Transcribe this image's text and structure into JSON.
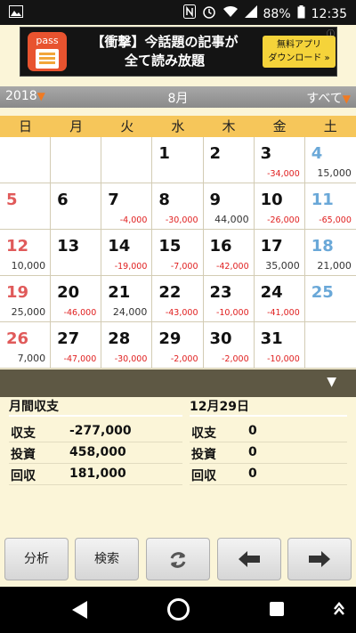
{
  "status": {
    "battery": "88%",
    "time": "12:35"
  },
  "ad": {
    "text_line1": "【衝撃】今話題の記事が",
    "text_line2": "全て読み放題",
    "logo_text": "pass",
    "cta_line1": "無料アプリ",
    "cta_line2": "ダウンロード »",
    "info": "ⓘ"
  },
  "header": {
    "year": "2018",
    "month": "8月",
    "filter": "すべて"
  },
  "weekdays": [
    "日",
    "月",
    "火",
    "水",
    "木",
    "金",
    "土"
  ],
  "weeks": [
    [
      {
        "d": "",
        "v": ""
      },
      {
        "d": "",
        "v": ""
      },
      {
        "d": "",
        "v": ""
      },
      {
        "d": "1",
        "v": ""
      },
      {
        "d": "2",
        "v": ""
      },
      {
        "d": "3",
        "v": "-34,000"
      },
      {
        "d": "4",
        "v": "15,000"
      }
    ],
    [
      {
        "d": "5",
        "v": ""
      },
      {
        "d": "6",
        "v": ""
      },
      {
        "d": "7",
        "v": "-4,000"
      },
      {
        "d": "8",
        "v": "-30,000"
      },
      {
        "d": "9",
        "v": "44,000"
      },
      {
        "d": "10",
        "v": "-26,000"
      },
      {
        "d": "11",
        "v": "-65,000"
      }
    ],
    [
      {
        "d": "12",
        "v": "10,000"
      },
      {
        "d": "13",
        "v": ""
      },
      {
        "d": "14",
        "v": "-19,000"
      },
      {
        "d": "15",
        "v": "-7,000"
      },
      {
        "d": "16",
        "v": "-42,000"
      },
      {
        "d": "17",
        "v": "35,000"
      },
      {
        "d": "18",
        "v": "21,000"
      }
    ],
    [
      {
        "d": "19",
        "v": "25,000"
      },
      {
        "d": "20",
        "v": "-46,000"
      },
      {
        "d": "21",
        "v": "24,000"
      },
      {
        "d": "22",
        "v": "-43,000"
      },
      {
        "d": "23",
        "v": "-10,000"
      },
      {
        "d": "24",
        "v": "-41,000"
      },
      {
        "d": "25",
        "v": ""
      }
    ],
    [
      {
        "d": "26",
        "v": "7,000"
      },
      {
        "d": "27",
        "v": "-47,000"
      },
      {
        "d": "28",
        "v": "-30,000"
      },
      {
        "d": "29",
        "v": "-2,000"
      },
      {
        "d": "30",
        "v": "-2,000"
      },
      {
        "d": "31",
        "v": "-10,000"
      },
      {
        "d": "",
        "v": ""
      }
    ]
  ],
  "summary": {
    "monthly": {
      "title": "月間収支",
      "rows": [
        {
          "label": "収支",
          "value": "-277,000"
        },
        {
          "label": "投資",
          "value": "458,000"
        },
        {
          "label": "回収",
          "value": "181,000"
        }
      ]
    },
    "day": {
      "title": "12月29日",
      "rows": [
        {
          "label": "収支",
          "value": "0"
        },
        {
          "label": "投資",
          "value": "0"
        },
        {
          "label": "回収",
          "value": "0"
        }
      ]
    }
  },
  "buttons": {
    "analysis": "分析",
    "search": "検索"
  },
  "colors": {
    "sunday": "#e05a5a",
    "saturday": "#6aa8d8",
    "negative": "#e02020",
    "weekday_header": "#f6c65a",
    "accent": "#f07a22"
  }
}
